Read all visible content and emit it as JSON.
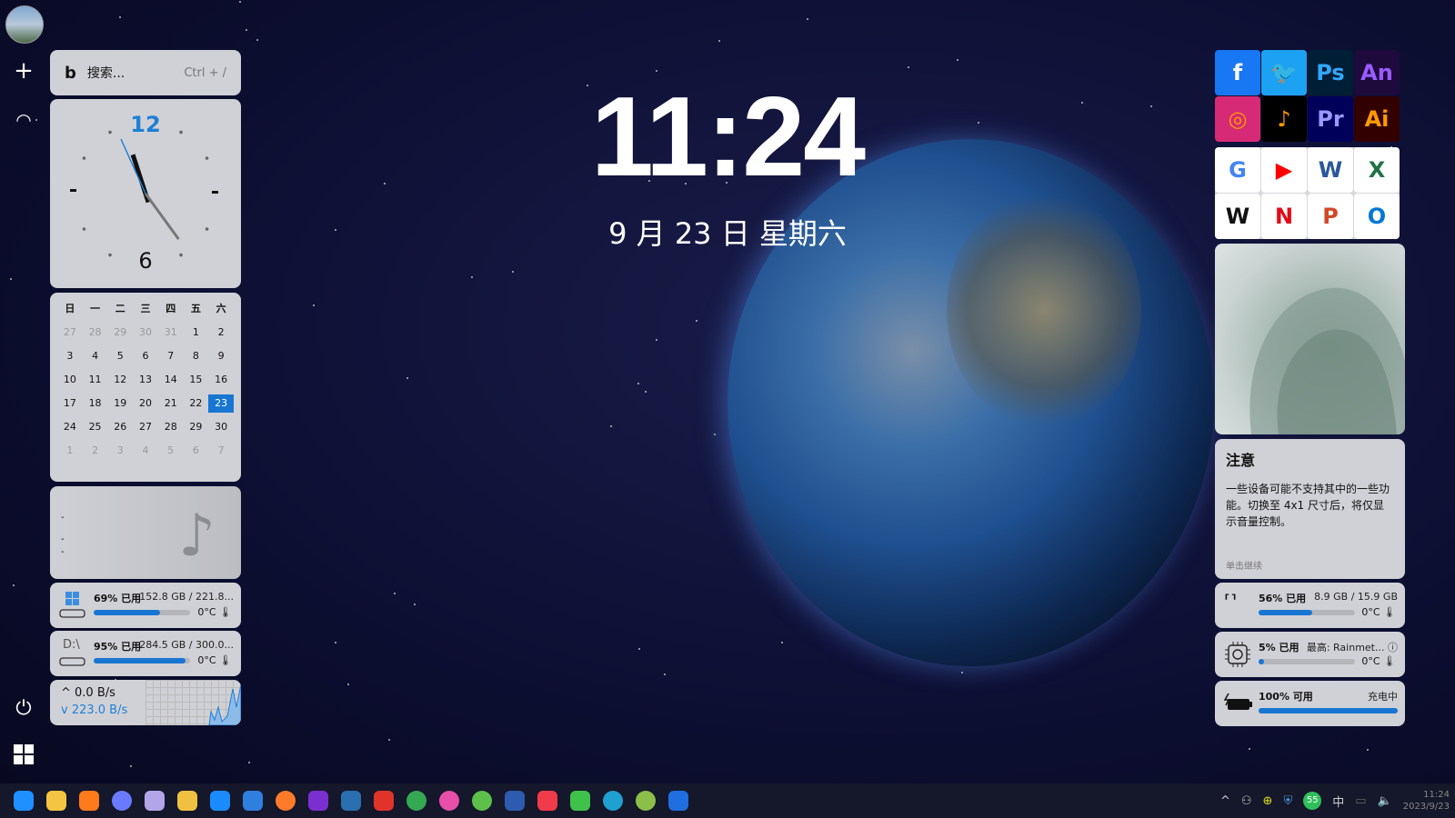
{
  "sidebar": {
    "icons": [
      "avatar",
      "plus-icon",
      "eye-icon",
      "power-icon",
      "start-icon"
    ]
  },
  "search": {
    "placeholder": "搜索...",
    "shortcut": "Ctrl + /",
    "icon": "bing-icon"
  },
  "clock": {
    "time": "11:24",
    "date": "9 月 23 日 星期六",
    "numeral_top": "12",
    "numeral_bottom": "6",
    "hour": 11,
    "minute": 24
  },
  "calendar": {
    "headers": [
      "日",
      "一",
      "二",
      "三",
      "四",
      "五",
      "六"
    ],
    "weeks": [
      [
        "27",
        "28",
        "29",
        "30",
        "31",
        "1",
        "2"
      ],
      [
        "3",
        "4",
        "5",
        "6",
        "7",
        "8",
        "9"
      ],
      [
        "10",
        "11",
        "12",
        "13",
        "14",
        "15",
        "16"
      ],
      [
        "17",
        "18",
        "19",
        "20",
        "21",
        "22",
        "23"
      ],
      [
        "24",
        "25",
        "26",
        "27",
        "28",
        "29",
        "30"
      ],
      [
        "1",
        "2",
        "3",
        "4",
        "5",
        "6",
        "7"
      ]
    ],
    "today": "23",
    "accent": "#1876d2"
  },
  "music": {
    "lines": [
      "-",
      "-",
      "-"
    ],
    "icon": "music-note-icon"
  },
  "disk_c": {
    "used": "69% 已用",
    "size": "152.8 GB / 221.8...",
    "temp": "0°C",
    "percent": 69
  },
  "disk_d": {
    "label": "D:\\",
    "used": "95% 已用",
    "size": "284.5 GB / 300.0...",
    "temp": "0°C",
    "percent": 95
  },
  "network": {
    "up": "0.0 B/s",
    "down": "223.0 B/s"
  },
  "apps": {
    "group1": [
      {
        "name": "Facebook",
        "label": "f",
        "color": "#1877f2"
      },
      {
        "name": "Twitter",
        "label": "🐦",
        "color": "#1da1f2"
      },
      {
        "name": "Photoshop",
        "label": "Ps",
        "color": "#001e36"
      },
      {
        "name": "Animate",
        "label": "An",
        "color": "#1e0b3c"
      },
      {
        "name": "Instagram",
        "label": "◎",
        "color": "#d62976"
      },
      {
        "name": "TikTok",
        "label": "♪",
        "color": "#000000"
      },
      {
        "name": "Premiere",
        "label": "Pr",
        "color": "#00005b"
      },
      {
        "name": "Illustrator",
        "label": "Ai",
        "color": "#330000"
      }
    ],
    "group2": [
      {
        "name": "Google",
        "label": "G",
        "color": "#ffffff"
      },
      {
        "name": "YouTube",
        "label": "▶",
        "color": "#ffffff"
      },
      {
        "name": "Word",
        "label": "W",
        "color": "#ffffff"
      },
      {
        "name": "Excel",
        "label": "X",
        "color": "#ffffff"
      },
      {
        "name": "Wikipedia",
        "label": "W",
        "color": "#ffffff"
      },
      {
        "name": "Netflix",
        "label": "N",
        "color": "#ffffff"
      },
      {
        "name": "PowerPoint",
        "label": "P",
        "color": "#ffffff"
      },
      {
        "name": "Outlook",
        "label": "O",
        "color": "#ffffff"
      }
    ]
  },
  "notice": {
    "title": "注意",
    "body": "一些设备可能不支持其中的一些功能。切换至 4x1 尺寸后，将仅显示音量控制。",
    "continue": "单击继续"
  },
  "ram": {
    "used": "56% 已用",
    "size": "8.9 GB / 15.9 GB",
    "temp": "0°C",
    "percent": 56
  },
  "cpu": {
    "used": "5% 已用",
    "top": "最高: Rainmet...",
    "temp": "0°C",
    "percent": 5
  },
  "battery": {
    "avail": "100% 可用",
    "status": "充电中",
    "percent": 100
  },
  "taskbar": {
    "apps": [
      {
        "name": "start",
        "color": "#1e90ff"
      },
      {
        "name": "file-explorer",
        "color": "#f4c542"
      },
      {
        "name": "search-tool",
        "color": "#ff7a1a"
      },
      {
        "name": "app-c",
        "color": "#6b7bff"
      },
      {
        "name": "app-save",
        "color": "#b3a6e8"
      },
      {
        "name": "xmind",
        "color": "#f0c040"
      },
      {
        "name": "app-bird",
        "color": "#1a8cff"
      },
      {
        "name": "app-k",
        "color": "#2f7fe0"
      },
      {
        "name": "firefox",
        "color": "#ff7b2a"
      },
      {
        "name": "app-infinity",
        "color": "#7b2fd0"
      },
      {
        "name": "app-v",
        "color": "#2a6fb0"
      },
      {
        "name": "wps",
        "color": "#e0342a"
      },
      {
        "name": "chrome",
        "color": "#34a853"
      },
      {
        "name": "app-color",
        "color": "#e84fa8"
      },
      {
        "name": "app-green",
        "color": "#5cc04a"
      },
      {
        "name": "app-wave",
        "color": "#2d5bb0"
      },
      {
        "name": "app-red",
        "color": "#ef3b4a"
      },
      {
        "name": "wechat",
        "color": "#3fc24a"
      },
      {
        "name": "edge",
        "color": "#1ea0d0"
      },
      {
        "name": "app-y",
        "color": "#8bbf4a"
      },
      {
        "name": "app-t",
        "color": "#1f6fe0"
      }
    ],
    "tray": {
      "ime": "中",
      "battery_badge": "55",
      "time": "11:24",
      "date": "2023/9/23"
    }
  }
}
